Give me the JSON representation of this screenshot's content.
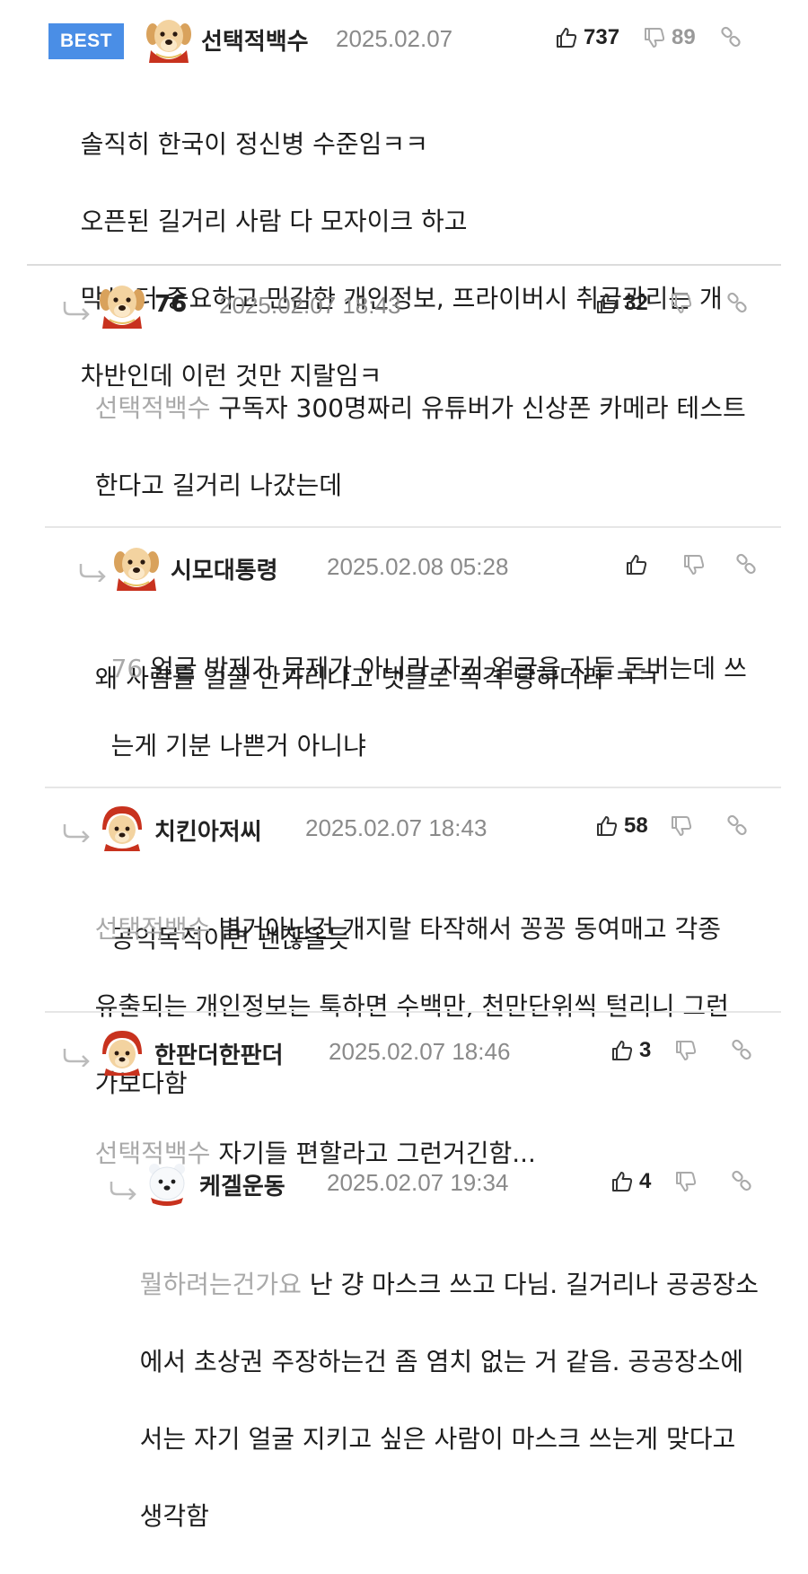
{
  "colors": {
    "best_badge": "#4a8ee6",
    "mention": "#a9a9a9",
    "date": "#8a8a8a",
    "separator": "#e6e6e6"
  },
  "best_label": "BEST",
  "comments": [
    {
      "nick": "선택적백수",
      "date": "2025.02.07",
      "up": "737",
      "down": "89",
      "avatar": "puppy-icon",
      "lines": [
        "솔직히 한국이 정신병 수준임ㅋㅋ",
        "오픈된 길거리 사람 다 모자이크 하고",
        "막상 더 중요하고 민감한 개인정보, 프라이버시 취급관리는 개",
        "차반인데 이런 것만 지랄임ㅋ"
      ]
    },
    {
      "nick": "76",
      "date": "2025.02.07 18:43",
      "up": "32",
      "down": "",
      "avatar": "puppy-icon",
      "mention": "선택적백수",
      "lines": [
        "구독자 300명짜리 유튜버가 신상폰 카메라 테스트",
        "한다고 길거리 나갔는데",
        "",
        "왜 사람들 얼굴 안가리냐고 댓글로 폭격 당하더라 ㅋㅋ"
      ]
    },
    {
      "nick": "시모대통령",
      "date": "2025.02.08 05:28",
      "up": "",
      "down": "",
      "avatar": "puppy-icon",
      "mention": "76",
      "lines": [
        "얼굴 박제가 문제가 아니라 자기 얼굴을 지들 돈버는데 쓰",
        "는게 기분 나쁜거 아니냐",
        "",
        "공익목적이면 괜찮을듯"
      ]
    },
    {
      "nick": "치킨아저씨",
      "date": "2025.02.07 18:43",
      "up": "58",
      "down": "",
      "avatar": "hooded-puppy-icon",
      "mention": "선택적백수",
      "lines": [
        "별거아닌건 개지랄 타작해서 꽁꽁 동여매고 각종",
        "유출되는 개인정보는 툭하면 수백만, 천만단위씩 털리니 그런",
        "가보다함"
      ]
    },
    {
      "nick": "한판더한판더",
      "date": "2025.02.07 18:46",
      "up": "3",
      "down": "",
      "avatar": "hooded-puppy-icon",
      "mention": "선택적백수",
      "lines": [
        "자기들 편할라고 그런거긴함..."
      ]
    },
    {
      "nick": "케겔운동",
      "date": "2025.02.07 19:34",
      "up": "4",
      "down": "",
      "avatar": "polar-bear-icon",
      "mention": "뭘하려는건가요",
      "lines": [
        "난 걍 마스크 쓰고 다님. 길거리나 공공장소",
        "에서 초상권 주장하는건 좀 염치 없는 거 같음. 공공장소에",
        "서는 자기 얼굴 지키고 싶은 사람이 마스크 쓰는게 맞다고",
        "생각함"
      ]
    }
  ]
}
